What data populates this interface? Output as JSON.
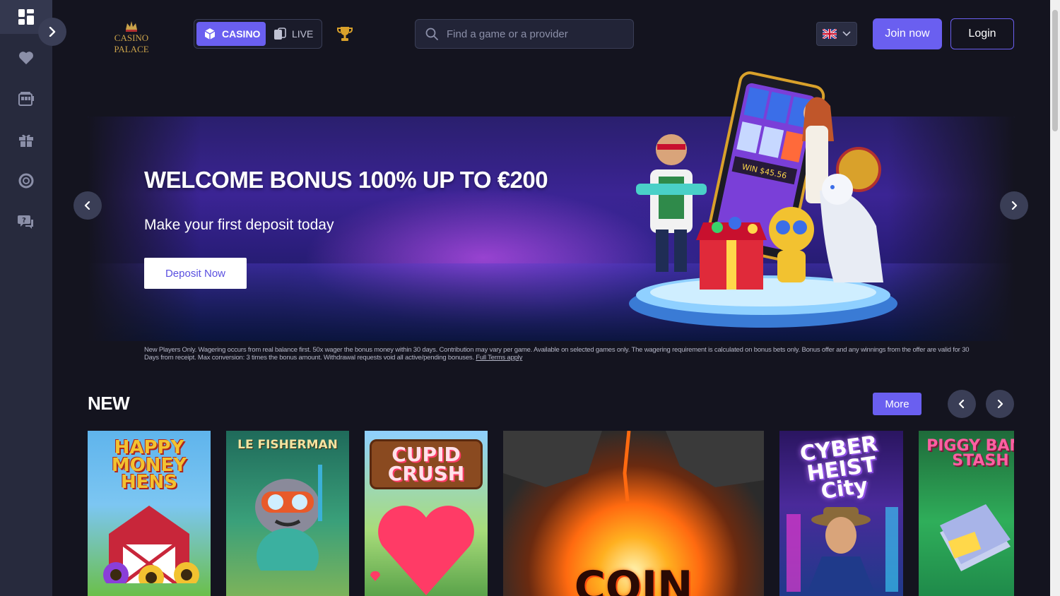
{
  "brand": {
    "logo_text": "CASINO PALACE"
  },
  "header": {
    "modes": [
      {
        "label": "CASINO",
        "active": true
      },
      {
        "label": "LIVE",
        "active": false
      }
    ],
    "search": {
      "placeholder": "Find a game or a provider",
      "value": ""
    },
    "language": "en-GB",
    "join_label": "Join now",
    "login_label": "Login"
  },
  "sidebar": {
    "items": [
      {
        "icon": "dashboard-icon",
        "active": true
      },
      {
        "icon": "heart-icon",
        "active": false
      },
      {
        "icon": "slot-machine-icon",
        "active": false
      },
      {
        "icon": "gift-icon",
        "active": false
      },
      {
        "icon": "lifebuoy-icon",
        "active": false
      },
      {
        "icon": "support-chat-icon",
        "active": false
      }
    ]
  },
  "banner": {
    "title": "WELCOME BONUS 100% UP TO €200",
    "subtitle": "Make your first deposit today",
    "cta_label": "Deposit Now",
    "terms": "New Players Only. Wagering occurs from real balance first. 50x wager the bonus money within 30 days. Contribution may vary per game. Available on selected games only. The wagering requirement is calculated on bonus bets only. Bonus offer and any winnings from the offer are valid for 30 Days from receipt. Max conversion: 3 times the bonus amount. Withdrawal requests void all active/pending bonuses.",
    "terms_link": "Full Terms apply",
    "art_win_text": "WIN $45.56"
  },
  "new_section": {
    "title": "NEW",
    "more_label": "More",
    "games": [
      {
        "title": "HAPPY MONEY HENS",
        "bg": "#4fa3e0",
        "accent": "#f2c230"
      },
      {
        "title": "LE FISHERMAN",
        "bg": "#2e8f6a",
        "accent": "#f3e3a0"
      },
      {
        "title": "CUPID CRUSH",
        "bg": "#7cc46a",
        "accent": "#ff3b66"
      },
      {
        "title": "COIN",
        "bg": "#2b2b2b",
        "accent": "#ff7a1a"
      },
      {
        "title": "CYBER HEIST City",
        "bg": "#3b1d7a",
        "accent": "#c07bff"
      },
      {
        "title": "PIGGY BANK STASH",
        "bg": "#1f8a4a",
        "accent": "#ff5fa2"
      }
    ]
  },
  "colors": {
    "accent": "#6a5ff0",
    "sidebar": "#272a3d",
    "background": "#14141f"
  }
}
